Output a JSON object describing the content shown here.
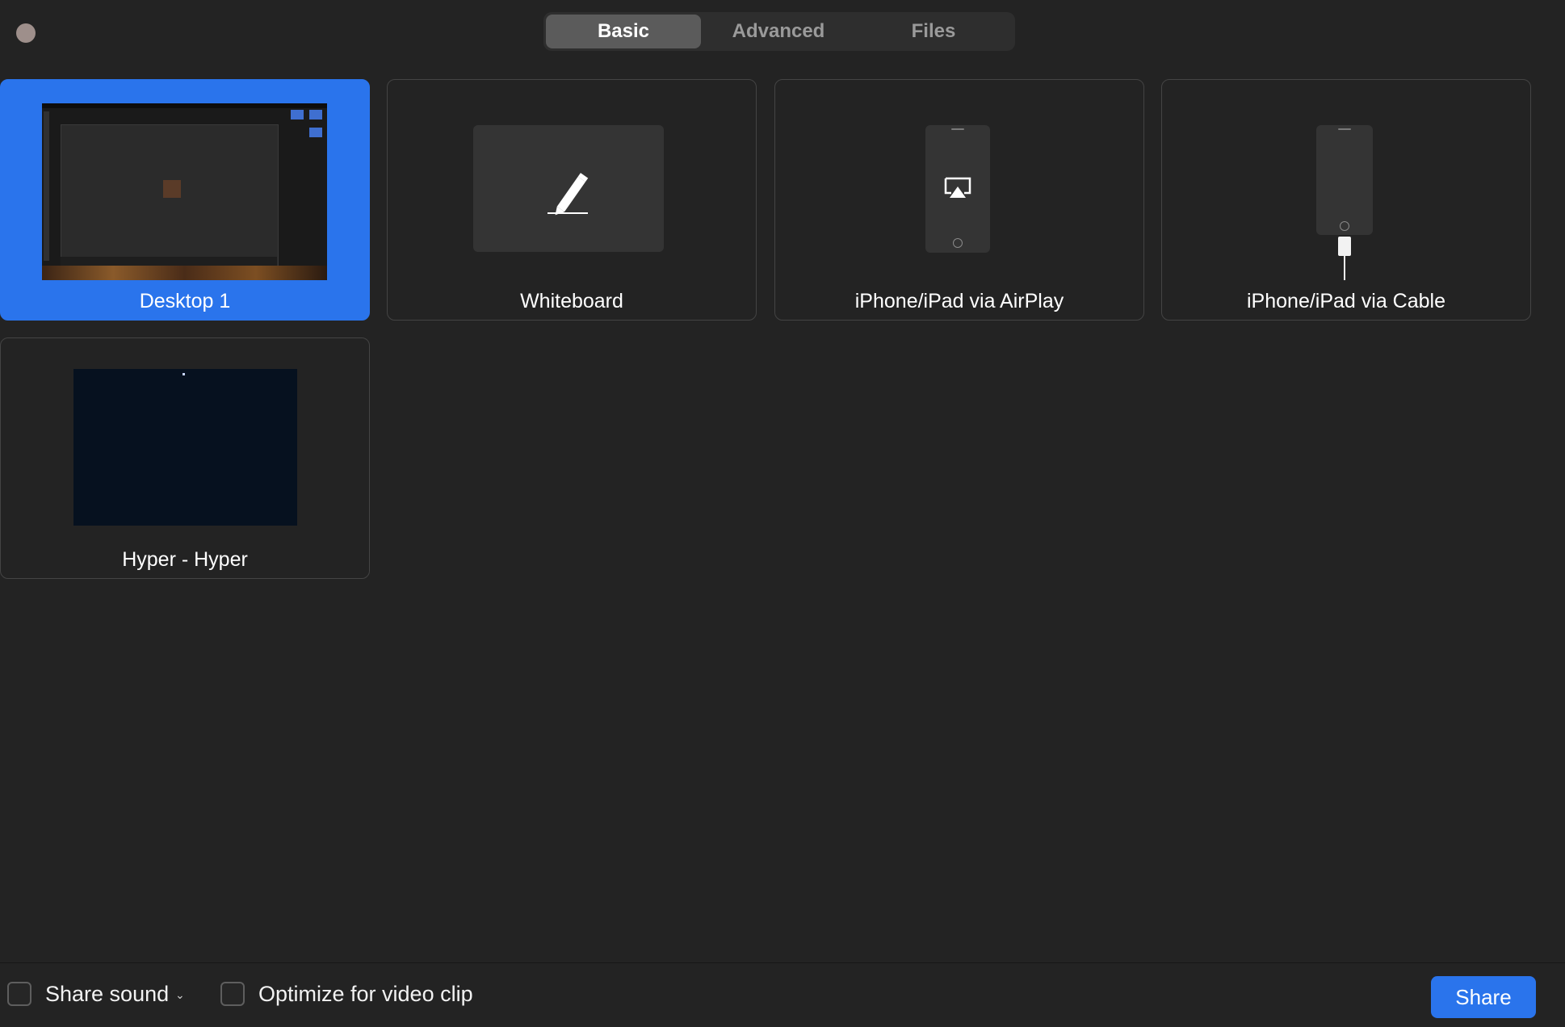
{
  "window": {
    "close_icon": "close-dot-icon"
  },
  "tabs": [
    {
      "label": "Basic",
      "active": true
    },
    {
      "label": "Advanced",
      "active": false
    },
    {
      "label": "Files",
      "active": false
    }
  ],
  "sources": [
    {
      "label": "Desktop 1",
      "selected": true,
      "icon": "desktop-thumbnail"
    },
    {
      "label": "Whiteboard",
      "selected": false,
      "icon": "whiteboard-pen-icon"
    },
    {
      "label": "iPhone/iPad via AirPlay",
      "selected": false,
      "icon": "airplay-phone-icon"
    },
    {
      "label": "iPhone/iPad via Cable",
      "selected": false,
      "icon": "cable-phone-icon"
    },
    {
      "label": "Hyper - Hyper",
      "selected": false,
      "icon": "hyper-window-thumbnail"
    }
  ],
  "bottom": {
    "share_sound_label": "Share sound",
    "share_sound_checked": false,
    "optimize_label": "Optimize for video clip",
    "optimize_checked": false,
    "share_button_label": "Share"
  },
  "colors": {
    "background": "#232323",
    "accent": "#2a74ec",
    "tile_border": "#444444"
  }
}
